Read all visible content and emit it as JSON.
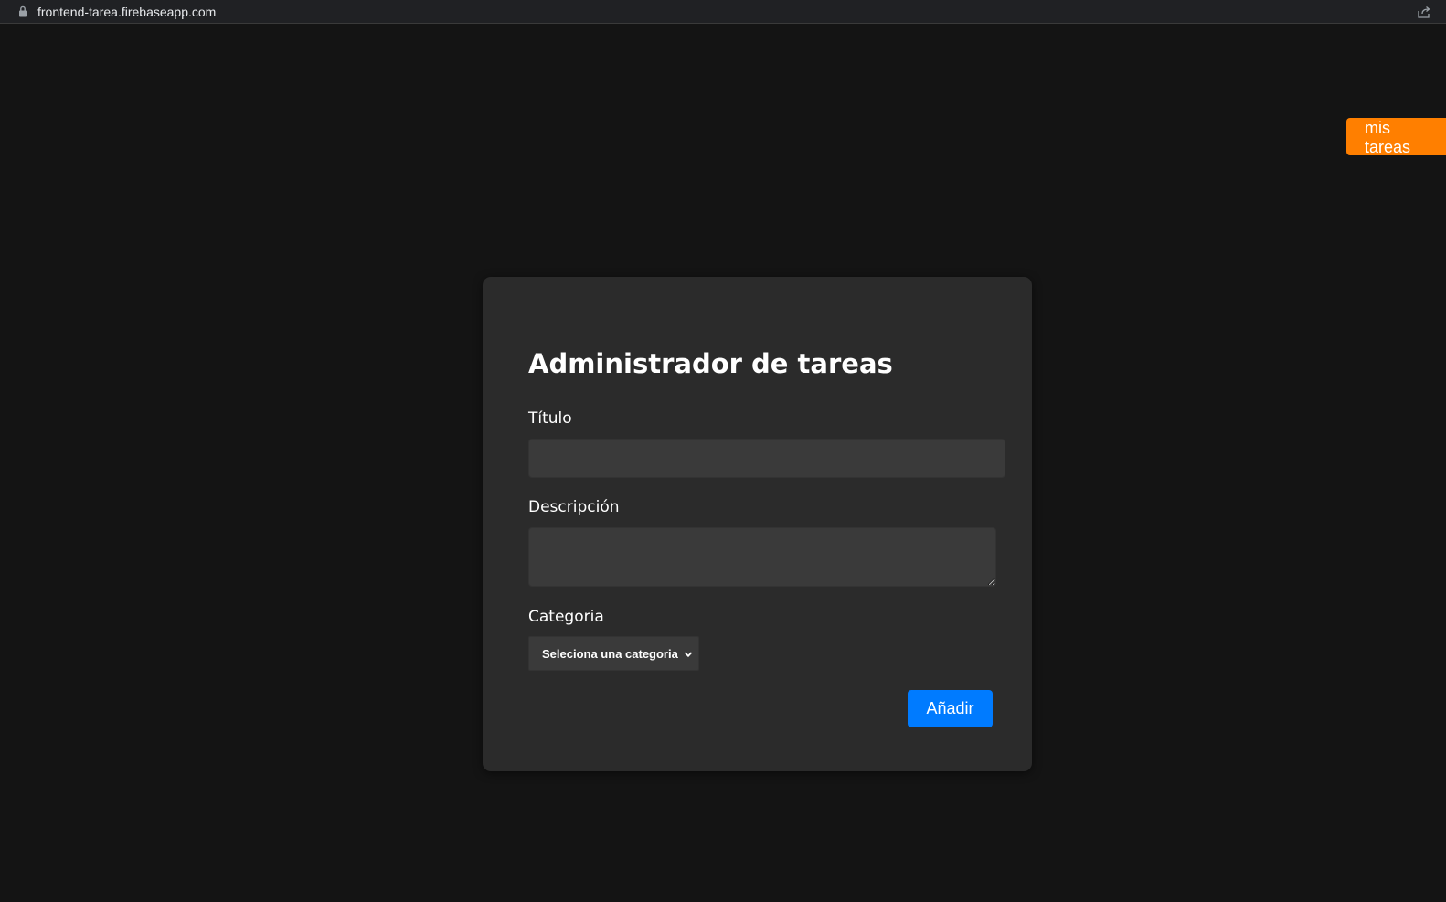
{
  "browser": {
    "url": "frontend-tarea.firebaseapp.com",
    "lock_icon": "lock-icon",
    "share_icon": "share-icon"
  },
  "nav": {
    "mis_tareas_label": "mis tareas",
    "mis_tareas_color": "#ff7f00"
  },
  "form": {
    "heading": "Administrador de tareas",
    "titulo_label": "Título",
    "titulo_value": "",
    "descripcion_label": "Descripción",
    "descripcion_value": "",
    "categoria_label": "Categoria",
    "categoria_selected": "Seleciona una categoria",
    "submit_label": "Añadir",
    "submit_color": "#007bff"
  }
}
